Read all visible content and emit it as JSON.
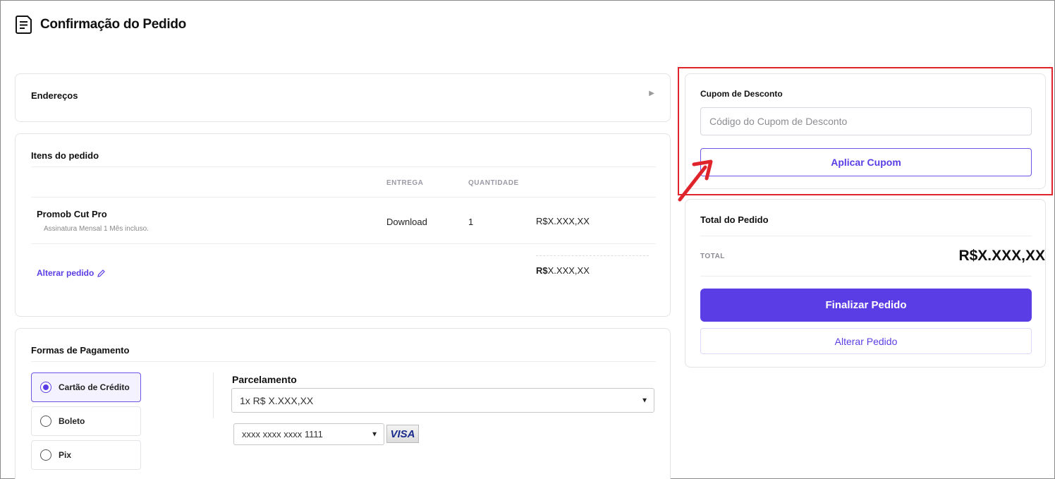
{
  "page": {
    "title": "Confirmação do Pedido",
    "accent_color": "#5b3de6",
    "highlight_color": "#e0242b"
  },
  "enderecos": {
    "title": "Endereços",
    "expand_icon": "triangle-right-icon"
  },
  "itens": {
    "title": "Itens do pedido",
    "columns": [
      "",
      "ENTREGA",
      "QUANTIDADE",
      ""
    ],
    "rows": [
      {
        "name": "Promob Cut Pro",
        "description": "Assinatura Mensal 1 Mês incluso.",
        "delivery": "Download",
        "quantity": "1",
        "price": "R$X.XXX,XX"
      }
    ],
    "alterar_label": "Alterar pedido",
    "subtotal_currency": "R$",
    "subtotal_value": "X.XXX,XX"
  },
  "pagamento": {
    "title": "Formas de Pagamento",
    "options": [
      {
        "label": "Cartão de Crédito",
        "selected": true
      },
      {
        "label": "Boleto",
        "selected": false
      },
      {
        "label": "Pix",
        "selected": false
      }
    ],
    "parcelamento_label": "Parcelamento",
    "parcelamento_value": "1x R$ X.XXX,XX",
    "card_value": "xxxx xxxx xxxx 1111",
    "card_brand": "VISA"
  },
  "cupom": {
    "title": "Cupom de Desconto",
    "placeholder": "Código do Cupom de Desconto",
    "apply_label": "Aplicar Cupom"
  },
  "total": {
    "title": "Total do Pedido",
    "label": "TOTAL",
    "value": "R$X.XXX,XX",
    "finalizar_label": "Finalizar Pedido",
    "alterar_label": "Alterar Pedido"
  }
}
